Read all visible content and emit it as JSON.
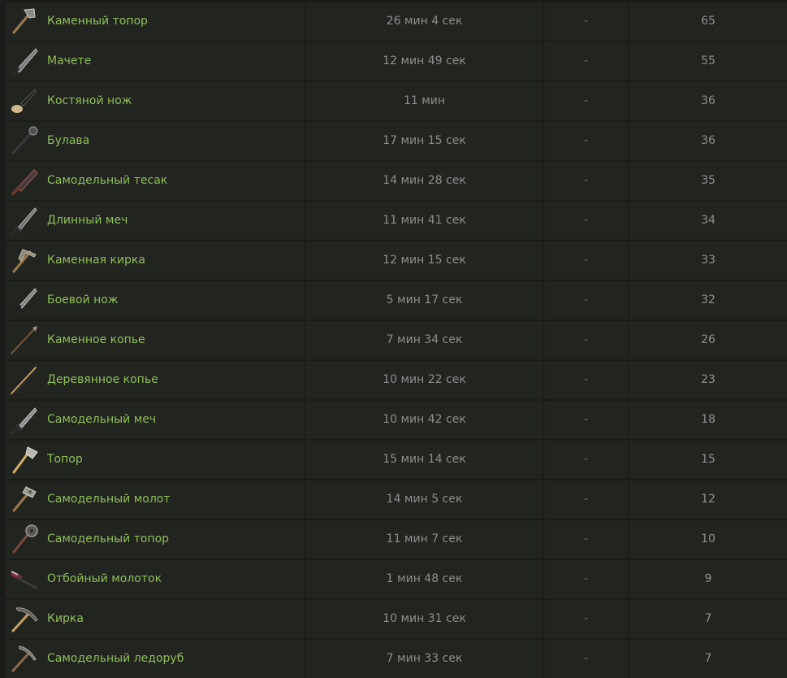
{
  "colors": {
    "background": "#1b1c1a",
    "cell": "#222420",
    "name_text": "#8fbf57",
    "value_text": "#8e8e8e"
  },
  "rows": [
    {
      "name": "Каменный топор",
      "time": "26 мин 4 сек",
      "extra": "-",
      "value": "65",
      "icon": "stone-axe-icon"
    },
    {
      "name": "Мачете",
      "time": "12 мин 49 сек",
      "extra": "-",
      "value": "55",
      "icon": "machete-icon"
    },
    {
      "name": "Костяной нож",
      "time": "11 мин",
      "extra": "-",
      "value": "36",
      "icon": "bone-knife-icon"
    },
    {
      "name": "Булава",
      "time": "17 мин 15 сек",
      "extra": "-",
      "value": "36",
      "icon": "mace-icon"
    },
    {
      "name": "Самодельный тесак",
      "time": "14 мин 28 сек",
      "extra": "-",
      "value": "35",
      "icon": "salvaged-cleaver-icon"
    },
    {
      "name": "Длинный меч",
      "time": "11 мин 41 сек",
      "extra": "-",
      "value": "34",
      "icon": "longsword-icon"
    },
    {
      "name": "Каменная кирка",
      "time": "12 мин 15 сек",
      "extra": "-",
      "value": "33",
      "icon": "stone-pickaxe-icon"
    },
    {
      "name": "Боевой нож",
      "time": "5 мин 17 сек",
      "extra": "-",
      "value": "32",
      "icon": "combat-knife-icon"
    },
    {
      "name": "Каменное копье",
      "time": "7 мин 34 сек",
      "extra": "-",
      "value": "26",
      "icon": "stone-spear-icon"
    },
    {
      "name": "Деревянное копье",
      "time": "10 мин 22 сек",
      "extra": "-",
      "value": "23",
      "icon": "wooden-spear-icon"
    },
    {
      "name": "Самодельный меч",
      "time": "10 мин 42 сек",
      "extra": "-",
      "value": "18",
      "icon": "salvaged-sword-icon"
    },
    {
      "name": "Топор",
      "time": "15 мин 14 сек",
      "extra": "-",
      "value": "15",
      "icon": "hatchet-icon"
    },
    {
      "name": "Самодельный молот",
      "time": "14 мин 5 сек",
      "extra": "-",
      "value": "12",
      "icon": "salvaged-hammer-icon"
    },
    {
      "name": "Самодельный топор",
      "time": "11 мин 7 сек",
      "extra": "-",
      "value": "10",
      "icon": "salvaged-axe-icon"
    },
    {
      "name": "Отбойный молоток",
      "time": "1 мин 48 сек",
      "extra": "-",
      "value": "9",
      "icon": "jackhammer-icon"
    },
    {
      "name": "Кирка",
      "time": "10 мин 31 сек",
      "extra": "-",
      "value": "7",
      "icon": "pickaxe-icon"
    },
    {
      "name": "Самодельный ледоруб",
      "time": "7 мин 33 сек",
      "extra": "-",
      "value": "7",
      "icon": "salvaged-icepick-icon"
    }
  ]
}
